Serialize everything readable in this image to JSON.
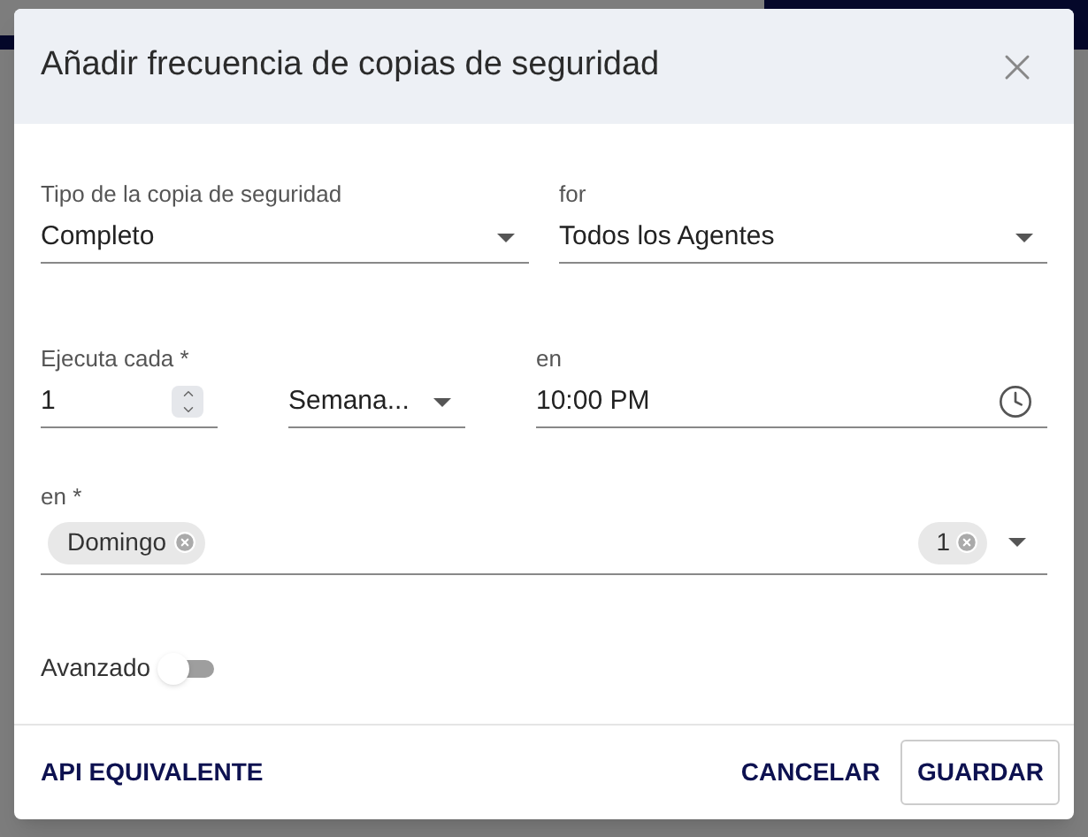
{
  "dialog": {
    "title": "Añadir frecuencia de copias de seguridad"
  },
  "row_1": [
    {
      "kind": "select",
      "label": "Tipo de la copia de seguridad",
      "value": "Completo"
    },
    {
      "kind": "select",
      "label": "for",
      "value": "Todos los Agentes"
    }
  ],
  "row_2": [
    {
      "kind": "number",
      "label": "Ejecuta cada *",
      "value": "1"
    },
    {
      "kind": "select",
      "value": "Semana..."
    },
    {
      "kind": "time",
      "label": "en",
      "value": "10:00 PM"
    }
  ],
  "days_field": {
    "label": "en *",
    "chips": [
      {
        "label": "Domingo"
      }
    ],
    "extra_count": "1"
  },
  "advanced_toggle": {
    "label": "Avanzado",
    "on": false
  },
  "footer_buttons": [
    {
      "label": "API EQUIVALENTE",
      "kind": "text"
    },
    {
      "label": "CANCELAR",
      "kind": "text"
    },
    {
      "label": "GUARDAR",
      "kind": "outlined"
    }
  ]
}
